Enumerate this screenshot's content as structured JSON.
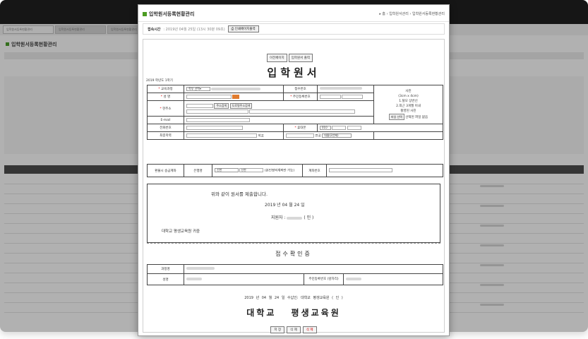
{
  "background": {
    "tabs": [
      "입학원서등록현황관리",
      "입학원서등록현황관리",
      "입학원서등록현황관리"
    ],
    "title": "입학원서등록현황관리"
  },
  "popup": {
    "title": "입학원서등록현황관리",
    "breadcrumb": "▸ 홈 › 입학원서관리 › 입학원서등록현황관리",
    "session_label": "접속시간",
    "session_value": ": 2019년 04월 25일 (13시 30분 09초)",
    "print_button": "인쇄페이지출력"
  },
  "form": {
    "nav_prev": "이전페이지",
    "nav_print": "입학원서 출력",
    "title": "입학원서",
    "year_label": "2019 학년도 1학기",
    "course_label": "교육과정",
    "course_value": "학부 선택▾",
    "receipt_no_label": "접수번호",
    "name_label": "성 명",
    "rrn_label": "주민등록번호",
    "address_label": "현주소",
    "addr_search": "주소검색",
    "addr_road": "도로명주소검색",
    "email_label": "E-mail",
    "phone_label": "전화번호",
    "mobile_label": "휴대폰",
    "mobile_prefix": "010",
    "school_label": "최종학력",
    "school_sub": "학교",
    "major_sub": "전공",
    "major_select": "대졸(2년제)",
    "photo": [
      "사진",
      "(3cm x 4cm)",
      "1.탈모 상반신",
      "2.최근 3개월 이내",
      "촬영된 사진"
    ],
    "file_button": "파일 선택",
    "file_status": "선택된 파일 없음",
    "refund_label": "환불시 송금계좌",
    "bank_label": "은행명",
    "bank_select": "신한",
    "holder_value": "신한",
    "holder_note": "(본인명의계좌만 가능)",
    "account_label": "계좌번호",
    "declare_text": "위와 같이 원서를 제출합니다.",
    "declare_date": "2019 년  04 월  24 일",
    "applicant": "지원자 :",
    "applicant_seal": "( 인 )",
    "to": "대학교  평생교육원 귀중",
    "receipt_title": "접수확인증",
    "r_course_label": "과정명",
    "r_name_label": "성명",
    "r_rrn_label": "주민등록번호 (앞자리)",
    "receipt_date": "2019 년  04 월  24 일   수납인:     대학교  평생교육원 ( 인 )",
    "receipt_org_a": "대학교",
    "receipt_org_b": "평생교육원",
    "btn_save": "저 장",
    "btn_edit": "삭 제",
    "btn_delete": "삭 제"
  }
}
